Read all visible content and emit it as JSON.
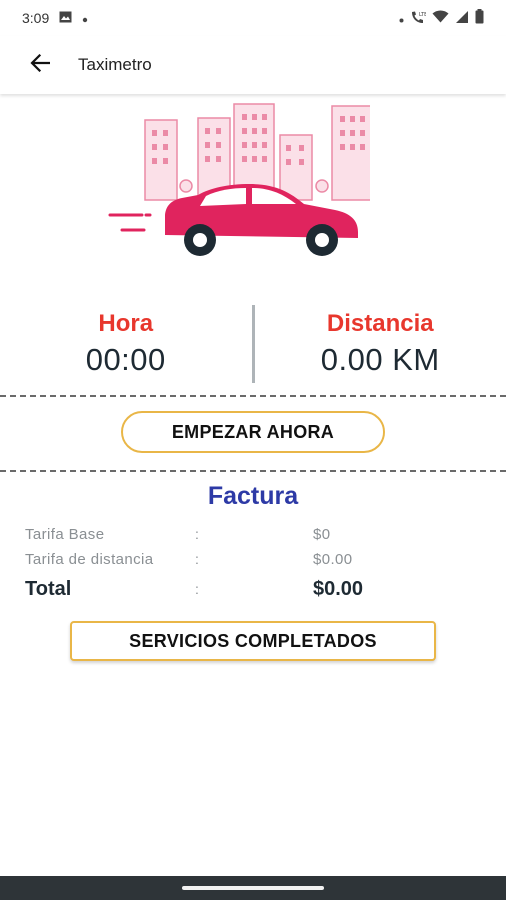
{
  "status_bar": {
    "time": "3:09",
    "icons": [
      "image-icon",
      "dot-icon",
      "wifi-calling-icon",
      "wifi-icon",
      "signal-icon",
      "battery-icon"
    ]
  },
  "app_bar": {
    "title": "Taximetro",
    "back_icon": "arrow-back-icon"
  },
  "illustration": {
    "subject": "taxi-city-icon",
    "accent_color": "#e0245e",
    "building_color": "#f4b6c8"
  },
  "stats": {
    "time_label": "Hora",
    "time_value": "00:00",
    "distance_label": "Distancia",
    "distance_value": "0.00 KM",
    "label_color": "#e8372d"
  },
  "buttons": {
    "start_label": "EMPEZAR AHORA",
    "services_label": "SERVICIOS COMPLETADOS",
    "border_color": "#e9b647"
  },
  "invoice": {
    "title": "Factura",
    "rows": [
      {
        "label": "Tarifa Base",
        "colon": ":",
        "value": "$0"
      },
      {
        "label": "Tarifa de distancia",
        "colon": ":",
        "value": "$0.00"
      }
    ],
    "total": {
      "label": "Total",
      "colon": ":",
      "value": "$0.00"
    }
  }
}
